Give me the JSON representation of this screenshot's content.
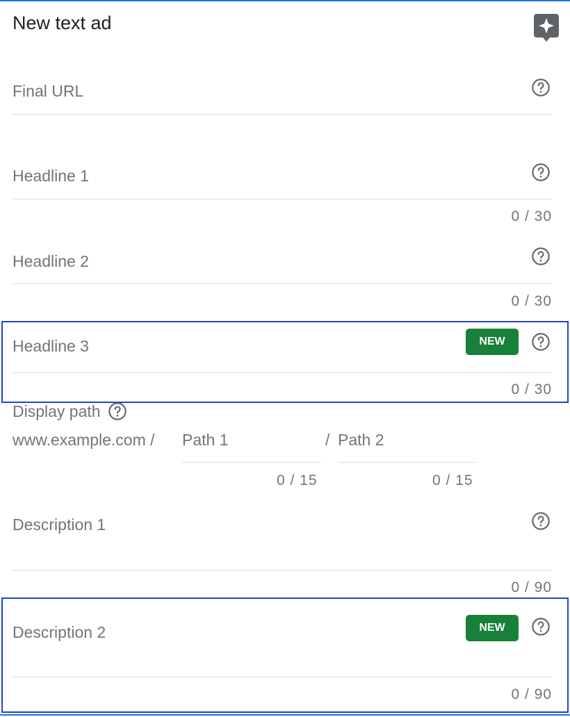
{
  "header": {
    "title": "New text ad"
  },
  "fields": {
    "final_url": {
      "label": "Final URL"
    },
    "headline1": {
      "label": "Headline 1",
      "counter": "0 / 30"
    },
    "headline2": {
      "label": "Headline 2",
      "counter": "0 / 30"
    },
    "headline3": {
      "label": "Headline 3",
      "counter": "0 / 30",
      "badge": "NEW"
    },
    "display_path": {
      "label": "Display path",
      "domain": "www.example.com /",
      "separator": "/",
      "path1": {
        "placeholder": "Path 1",
        "counter": "0 / 15"
      },
      "path2": {
        "placeholder": "Path 2",
        "counter": "0 / 15"
      }
    },
    "description1": {
      "label": "Description 1",
      "counter": "0 / 90"
    },
    "description2": {
      "label": "Description 2",
      "counter": "0 / 90",
      "badge": "NEW"
    }
  },
  "icons": {
    "assist": "sparkle-speech-bubble-icon",
    "help": "help-circle-icon"
  },
  "colors": {
    "accent_line": "#1a73e8",
    "highlight_border": "#2244cc",
    "badge_bg": "#188038",
    "label_text": "#707579",
    "underline": "#dadce0"
  }
}
